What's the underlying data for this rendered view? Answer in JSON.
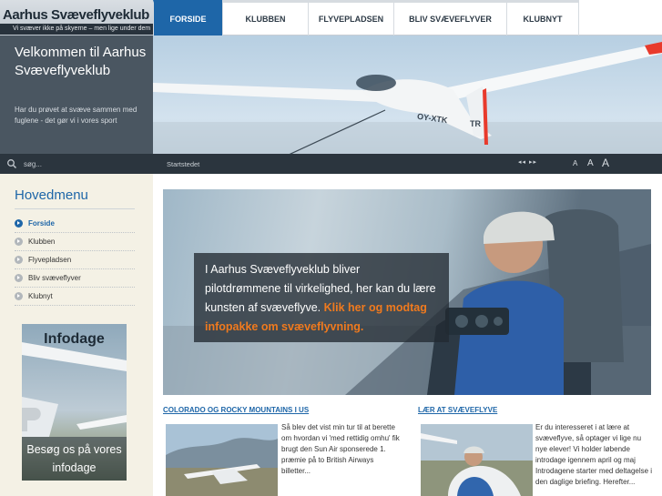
{
  "site": {
    "title": "Aarhus Svæveflyveklub",
    "tagline": "Vi svæver ikke på skyerne – men lige under dem"
  },
  "nav": {
    "tabs": [
      {
        "label": "FORSIDE",
        "active": true
      },
      {
        "label": "KLUBBEN",
        "active": false
      },
      {
        "label": "FLYVEPLADSEN",
        "active": false
      },
      {
        "label": "BLIV SVÆVEFLYVER",
        "active": false
      },
      {
        "label": "KLUBNYT",
        "active": false
      }
    ]
  },
  "hero": {
    "heading": "Velkommen til Aarhus Svæveflyveklub",
    "intro": "Har du prøvet at svæve sammen med fuglene - det gør vi i vores sport",
    "caption": "Startstedet",
    "aircraft_registration": "OY-XTK",
    "tail_code": "TR",
    "slide_controls": "◂◂  ▸▸",
    "font_size_labels": [
      "A",
      "A",
      "A"
    ]
  },
  "search": {
    "placeholder": "søg..."
  },
  "sidebar": {
    "heading": "Hovedmenu",
    "items": [
      {
        "label": "Forside",
        "active": true
      },
      {
        "label": "Klubben",
        "active": false
      },
      {
        "label": "Flyvepladsen",
        "active": false
      },
      {
        "label": "Bliv svæveflyver",
        "active": false
      },
      {
        "label": "Klubnyt",
        "active": false
      }
    ],
    "infodage": {
      "label": "Infodage",
      "cta": "Besøg os på vores infodage"
    }
  },
  "feature": {
    "text": "I Aarhus Svæveflyveklub bliver pilotdrømmene til virkelighed, her kan du lære kunsten af svæveflyve.",
    "link": "Klik her og modtag infopakke om svæveflyvning."
  },
  "articles": [
    {
      "title": "COLORADO OG ROCKY MOUNTAINS I US",
      "text": "Så blev det vist min tur til at berette om hvordan vi 'med rettidig omhu' fik brugt den Sun Air sponserede 1. præmie på to British Airways billetter..."
    },
    {
      "title": "LÆR AT SVÆVEFLYVE",
      "text": "Er du interesseret i at lære at svæveflyve, så optager vi lige nu nye elever! Vi holder løbende introdage igennem april og maj Introdagene starter med deltagelse i den daglige briefing. Herefter..."
    }
  ],
  "colors": {
    "accent": "#1e66a8",
    "link_orange": "#f07a1e",
    "dark_panel": "#4a5661",
    "sidebar_bg": "#f4f1e5"
  }
}
